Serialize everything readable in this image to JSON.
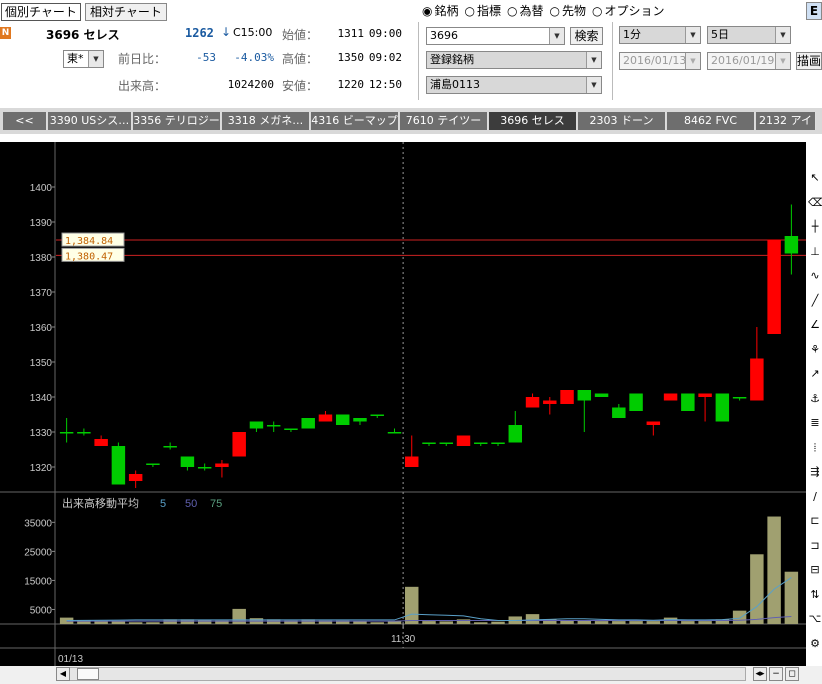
{
  "header": {
    "tab_individual": "個別チャート",
    "tab_relative": "相対チャート",
    "code_name": "3696 セレス",
    "last_price": "1262",
    "arrow": "↓",
    "c_time": "C15:00",
    "change_label": "前日比：",
    "change_value": "-53",
    "change_pct": "-4.03%",
    "volume_label": "出来高：",
    "volume_value": "1024200",
    "market_select": "東*",
    "open_label": "始値：",
    "open_value": "1311",
    "open_time": "09:00",
    "high_label": "高値：",
    "high_value": "1350",
    "high_time": "09:02",
    "low_label": "安値：",
    "low_value": "1220",
    "low_time": "12:50",
    "badge_n": "N"
  },
  "radios": [
    {
      "label": "銘柄",
      "selected": true
    },
    {
      "label": "指標",
      "selected": false
    },
    {
      "label": "為替",
      "selected": false
    },
    {
      "label": "先物",
      "selected": false
    },
    {
      "label": "オプション",
      "selected": false
    }
  ],
  "controls": {
    "symbol_input": "3696",
    "search_button": "検索",
    "registered_select": "登録銘柄",
    "list_select": "浦島0113",
    "interval_select": "1分",
    "period_select": "5日",
    "date_from": "2016/01/13",
    "date_to": "2016/01/19",
    "draw_button": "描画",
    "edge_button": "E"
  },
  "tabs": [
    {
      "label": "<<"
    },
    {
      "label": "3390 USシス…"
    },
    {
      "label": "3356 テリロジー"
    },
    {
      "label": "3318 メガネ…"
    },
    {
      "label": "4316 ビーマップ"
    },
    {
      "label": "7610 テイツー"
    },
    {
      "label": "3696 セレス"
    },
    {
      "label": "2303 ドーン"
    },
    {
      "label": "8462 FVC"
    },
    {
      "label": "2132 アイ"
    }
  ],
  "colors": {
    "up": "#00cc00",
    "down": "#ff0000",
    "volume": "#a0a070",
    "hline": "#cc2222",
    "axis_text": "#c8c8c8"
  },
  "chart_data": {
    "type": "candlestick",
    "price_ylim": [
      1310,
      1410
    ],
    "price_ticks": [
      1400,
      1390,
      1380,
      1370,
      1360,
      1350,
      1340,
      1330,
      1320
    ],
    "horizontal_lines": [
      {
        "value": 1384.84,
        "label": "1,384.84"
      },
      {
        "value": 1380.47,
        "label": "1,380.47"
      }
    ],
    "xlabel_time": "11:30",
    "xlabel_date": "01/13",
    "candles": [
      {
        "o": 1330,
        "h": 1334,
        "l": 1327,
        "c": 1330
      },
      {
        "o": 1330,
        "h": 1331,
        "l": 1329,
        "c": 1330
      },
      {
        "o": 1328,
        "h": 1329,
        "l": 1326,
        "c": 1326
      },
      {
        "o": 1315,
        "h": 1327,
        "l": 1315,
        "c": 1326
      },
      {
        "o": 1318,
        "h": 1319,
        "l": 1314,
        "c": 1316
      },
      {
        "o": 1321,
        "h": 1321,
        "l": 1320,
        "c": 1321
      },
      {
        "o": 1326,
        "h": 1327,
        "l": 1325,
        "c": 1326
      },
      {
        "o": 1320,
        "h": 1323,
        "l": 1319,
        "c": 1323
      },
      {
        "o": 1320,
        "h": 1321,
        "l": 1319,
        "c": 1320
      },
      {
        "o": 1321,
        "h": 1322,
        "l": 1317,
        "c": 1320
      },
      {
        "o": 1330,
        "h": 1330,
        "l": 1323,
        "c": 1323
      },
      {
        "o": 1331,
        "h": 1333,
        "l": 1330,
        "c": 1333
      },
      {
        "o": 1332,
        "h": 1333,
        "l": 1330,
        "c": 1332
      },
      {
        "o": 1331,
        "h": 1331,
        "l": 1330,
        "c": 1331
      },
      {
        "o": 1331,
        "h": 1334,
        "l": 1331,
        "c": 1334
      },
      {
        "o": 1335,
        "h": 1336,
        "l": 1334,
        "c": 1333
      },
      {
        "o": 1332,
        "h": 1335,
        "l": 1332,
        "c": 1335
      },
      {
        "o": 1333,
        "h": 1334,
        "l": 1332,
        "c": 1334
      },
      {
        "o": 1335,
        "h": 1335,
        "l": 1334,
        "c": 1335
      },
      {
        "o": 1330,
        "h": 1331,
        "l": 1330,
        "c": 1330
      },
      {
        "o": 1323,
        "h": 1329,
        "l": 1320,
        "c": 1320
      },
      {
        "o": 1327,
        "h": 1327,
        "l": 1326,
        "c": 1327
      },
      {
        "o": 1327,
        "h": 1327,
        "l": 1326,
        "c": 1327
      },
      {
        "o": 1329,
        "h": 1329,
        "l": 1326,
        "c": 1326
      },
      {
        "o": 1327,
        "h": 1327,
        "l": 1326,
        "c": 1327
      },
      {
        "o": 1327,
        "h": 1327,
        "l": 1326,
        "c": 1327
      },
      {
        "o": 1327,
        "h": 1336,
        "l": 1327,
        "c": 1332
      },
      {
        "o": 1340,
        "h": 1341,
        "l": 1337,
        "c": 1337
      },
      {
        "o": 1339,
        "h": 1340,
        "l": 1335,
        "c": 1338
      },
      {
        "o": 1342,
        "h": 1342,
        "l": 1338,
        "c": 1338
      },
      {
        "o": 1339,
        "h": 1342,
        "l": 1330,
        "c": 1342
      },
      {
        "o": 1340,
        "h": 1341,
        "l": 1340,
        "c": 1341
      },
      {
        "o": 1334,
        "h": 1338,
        "l": 1334,
        "c": 1337
      },
      {
        "o": 1336,
        "h": 1341,
        "l": 1336,
        "c": 1341
      },
      {
        "o": 1333,
        "h": 1333,
        "l": 1329,
        "c": 1332
      },
      {
        "o": 1341,
        "h": 1341,
        "l": 1339,
        "c": 1339
      },
      {
        "o": 1336,
        "h": 1341,
        "l": 1336,
        "c": 1341
      },
      {
        "o": 1341,
        "h": 1341,
        "l": 1333,
        "c": 1340
      },
      {
        "o": 1333,
        "h": 1341,
        "l": 1333,
        "c": 1341
      },
      {
        "o": 1340,
        "h": 1340,
        "l": 1339,
        "c": 1340
      },
      {
        "o": 1351,
        "h": 1360,
        "l": 1339,
        "c": 1339
      },
      {
        "o": 1385,
        "h": 1385,
        "l": 1358,
        "c": 1358
      },
      {
        "o": 1381,
        "h": 1395,
        "l": 1375,
        "c": 1386
      }
    ],
    "volume_title": "出来高移動平均",
    "volume_ma": [
      {
        "period": "5",
        "color": "#5aa0c8"
      },
      {
        "period": "50",
        "color": "#6060b0"
      },
      {
        "period": "75",
        "color": "#5aa080"
      }
    ],
    "volume_ylim": [
      0,
      42000
    ],
    "volume_ticks": [
      35000,
      25000,
      15000,
      5000
    ],
    "volumes": [
      2200,
      1200,
      1000,
      1000,
      600,
      600,
      1600,
      1600,
      1400,
      1200,
      5200,
      2000,
      1600,
      1200,
      1600,
      1200,
      1200,
      900,
      600,
      1000,
      12800,
      1000,
      900,
      1600,
      600,
      800,
      2600,
      3400,
      1600,
      1200,
      1200,
      1000,
      1000,
      1000,
      1000,
      2200,
      1000,
      1000,
      1600,
      4600,
      24000,
      37000,
      18000
    ],
    "ma5_line": [
      1200,
      1250,
      1300,
      1350,
      1400,
      1400,
      1400,
      1400,
      1400,
      1400,
      1400,
      1400,
      1400,
      1400,
      1400,
      1400,
      1400,
      1400,
      1400,
      1400,
      3400,
      3200,
      3000,
      2800,
      1800,
      1200,
      1200,
      1400,
      1600,
      1800,
      1800,
      1600,
      1400,
      1400,
      1300,
      1500,
      1400,
      1400,
      1500,
      2000,
      6000,
      12000,
      16000
    ],
    "ma50_line": [
      1000,
      1000,
      1000,
      1000,
      1000,
      1000,
      1000,
      1000,
      1000,
      1000,
      1000,
      1000,
      1000,
      1000,
      1000,
      1000,
      1000,
      1000,
      1000,
      1000,
      1200,
      1200,
      1200,
      1200,
      1200,
      1200,
      1200,
      1200,
      1200,
      1200,
      1200,
      1200,
      1200,
      1200,
      1200,
      1200,
      1200,
      1200,
      1200,
      1300,
      1600,
      2200,
      2600
    ]
  }
}
